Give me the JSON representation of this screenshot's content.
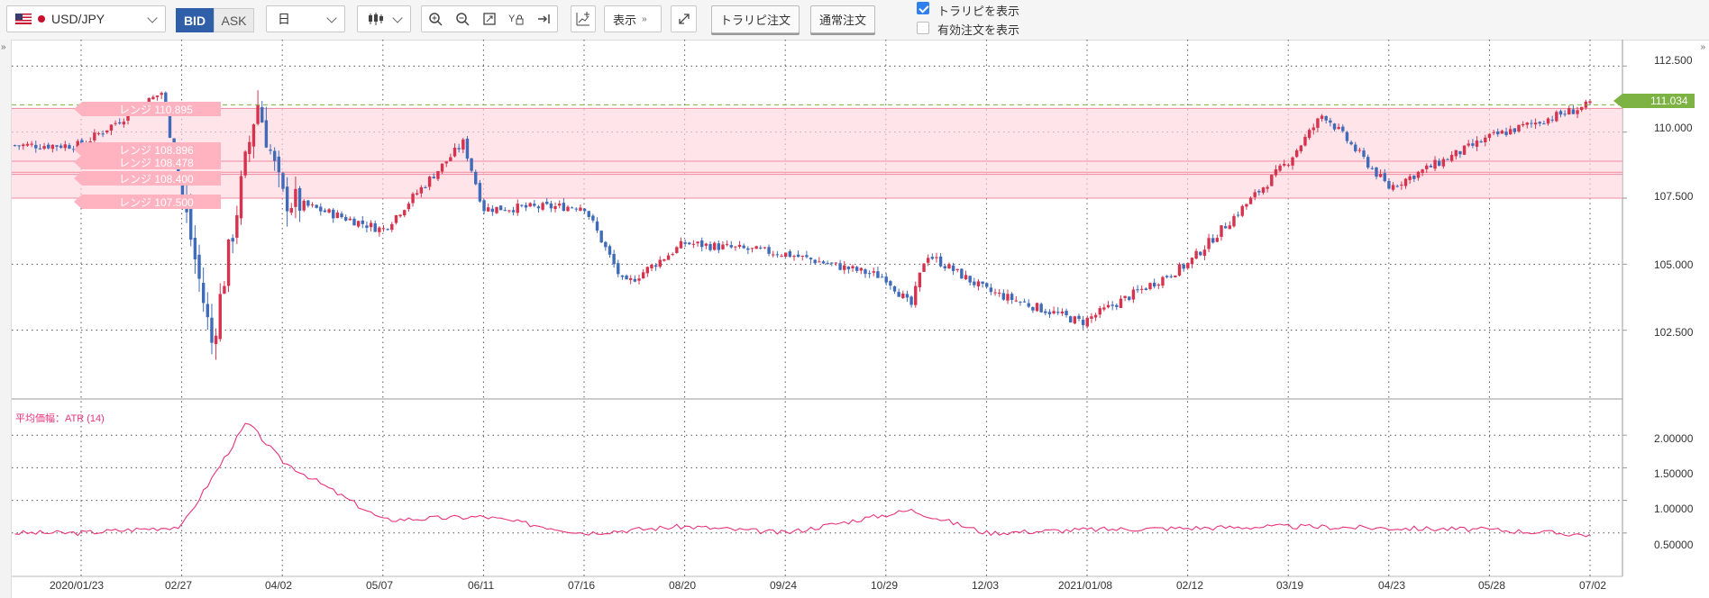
{
  "toolbar": {
    "symbol": "USD/JPY",
    "bid_label": "BID",
    "ask_label": "ASK",
    "period": "日",
    "display_label": "表示",
    "trapi_order_label": "トラリピ注文",
    "normal_order_label": "通常注文",
    "show_trapi_label": "トラリピを表示",
    "show_trapi_checked": true,
    "show_active_orders_label": "有効注文を表示",
    "show_active_orders_checked": false
  },
  "chart": {
    "current_price": "111.034",
    "price_axis_labels": [
      "112.500",
      "110.000",
      "107.500",
      "105.000",
      "102.500"
    ],
    "atr_title": "平均価幅：ATR (14)",
    "atr_axis_labels": [
      "2.00000",
      "1.50000",
      "1.00000",
      "0.50000"
    ],
    "date_labels": [
      "2020/01/23",
      "02/27",
      "04/02",
      "05/07",
      "06/11",
      "07/16",
      "08/20",
      "09/24",
      "10/29",
      "12/03",
      "2021/01/08",
      "02/12",
      "03/19",
      "04/23",
      "05/28",
      "07/02"
    ],
    "range_labels": [
      "レンジ 110.895",
      "レンジ 108.896",
      "レンジ 108.478",
      "レンジ 108.400",
      "レンジ 107.500"
    ],
    "colors": {
      "up": "#d6334e",
      "down": "#3f6bb8",
      "range_fill": "#ffd6dd",
      "range_line": "#f08aa0",
      "atr_line": "#e8337d",
      "current_line": "#7cb342"
    }
  },
  "chart_data": {
    "type": "candlestick",
    "instrument": "USD/JPY",
    "timeframe": "日",
    "price_ylim": [
      100.0,
      113.5
    ],
    "current_price": 111.034,
    "x_ticks": [
      "2020/01/23",
      "02/27",
      "04/02",
      "05/07",
      "06/11",
      "07/16",
      "08/20",
      "09/24",
      "10/29",
      "12/03",
      "2021/01/08",
      "02/12",
      "03/19",
      "04/23",
      "05/28",
      "07/02"
    ],
    "approx_close_path": [
      {
        "date": "2020/01/23",
        "close": 109.5
      },
      {
        "date": "02/20",
        "close": 111.5
      },
      {
        "date": "03/09",
        "close": 102.0
      },
      {
        "date": "03/24",
        "close": 111.2
      },
      {
        "date": "04/02",
        "close": 107.5
      },
      {
        "date": "05/07",
        "close": 106.3
      },
      {
        "date": "06/05",
        "close": 109.6
      },
      {
        "date": "06/11",
        "close": 107.1
      },
      {
        "date": "07/16",
        "close": 107.2
      },
      {
        "date": "07/31",
        "close": 104.2
      },
      {
        "date": "08/20",
        "close": 105.8
      },
      {
        "date": "09/24",
        "close": 105.4
      },
      {
        "date": "10/29",
        "close": 104.5
      },
      {
        "date": "11/06",
        "close": 103.4
      },
      {
        "date": "11/11",
        "close": 105.4
      },
      {
        "date": "12/03",
        "close": 104.0
      },
      {
        "date": "2021/01/06",
        "close": 102.8
      },
      {
        "date": "02/12",
        "close": 105.0
      },
      {
        "date": "03/19",
        "close": 108.9
      },
      {
        "date": "03/31",
        "close": 110.7
      },
      {
        "date": "04/23",
        "close": 107.9
      },
      {
        "date": "05/28",
        "close": 109.8
      },
      {
        "date": "07/02",
        "close": 111.03
      }
    ],
    "ranges": [
      110.895,
      108.896,
      108.478,
      108.4,
      107.5
    ],
    "atr": {
      "name": "ATR (14)",
      "ylim": [
        0.0,
        2.5
      ],
      "approx_path": [
        {
          "date": "2020/01/23",
          "value": 0.5
        },
        {
          "date": "02/27",
          "value": 0.6
        },
        {
          "date": "03/20",
          "value": 2.2
        },
        {
          "date": "04/02",
          "value": 1.6
        },
        {
          "date": "05/07",
          "value": 0.7
        },
        {
          "date": "06/11",
          "value": 0.75
        },
        {
          "date": "07/16",
          "value": 0.5
        },
        {
          "date": "08/20",
          "value": 0.6
        },
        {
          "date": "09/24",
          "value": 0.5
        },
        {
          "date": "11/06",
          "value": 0.85
        },
        {
          "date": "12/03",
          "value": 0.5
        },
        {
          "date": "2021/01/08",
          "value": 0.55
        },
        {
          "date": "03/19",
          "value": 0.6
        },
        {
          "date": "05/28",
          "value": 0.55
        },
        {
          "date": "07/02",
          "value": 0.47
        }
      ]
    },
    "grid": true
  }
}
